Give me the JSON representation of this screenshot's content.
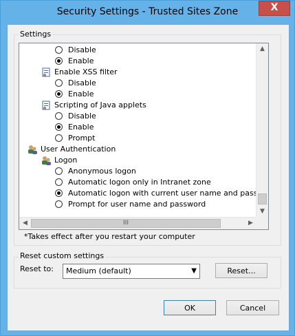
{
  "window": {
    "title": "Security Settings - Trusted Sites Zone",
    "close_glyph": "X"
  },
  "settings_group": {
    "label": "Settings"
  },
  "tree_items": [
    {
      "kind": "radio",
      "label": "Disable",
      "checked": false
    },
    {
      "kind": "radio",
      "label": "Enable",
      "checked": true
    },
    {
      "kind": "setting",
      "label": "Enable XSS filter"
    },
    {
      "kind": "radio",
      "label": "Disable",
      "checked": false
    },
    {
      "kind": "radio",
      "label": "Enable",
      "checked": true
    },
    {
      "kind": "setting",
      "label": "Scripting of Java applets"
    },
    {
      "kind": "radio",
      "label": "Disable",
      "checked": false
    },
    {
      "kind": "radio",
      "label": "Enable",
      "checked": true
    },
    {
      "kind": "radio",
      "label": "Prompt",
      "checked": false
    },
    {
      "kind": "category",
      "label": "User Authentication"
    },
    {
      "kind": "subcategory",
      "label": "Logon"
    },
    {
      "kind": "radio",
      "label": "Anonymous logon",
      "checked": false
    },
    {
      "kind": "radio",
      "label": "Automatic logon only in Intranet zone",
      "checked": false
    },
    {
      "kind": "radio",
      "label": "Automatic logon with current user name and password",
      "checked": true
    },
    {
      "kind": "radio",
      "label": "Prompt for user name and password",
      "checked": false
    }
  ],
  "note": "*Takes effect after you restart your computer",
  "reset_group": {
    "label": "Reset custom settings",
    "reset_to_label": "Reset to:",
    "selected": "Medium (default)",
    "reset_button": "Reset..."
  },
  "buttons": {
    "ok": "OK",
    "cancel": "Cancel"
  },
  "scroll_glyphs": {
    "up": "▲",
    "down": "▼",
    "left": "◀",
    "right": "▶",
    "grip": "III"
  },
  "colors": {
    "title_bar": "#64b2e8",
    "close_button": "#c7504a",
    "dialog_bg": "#f0f0f0"
  }
}
